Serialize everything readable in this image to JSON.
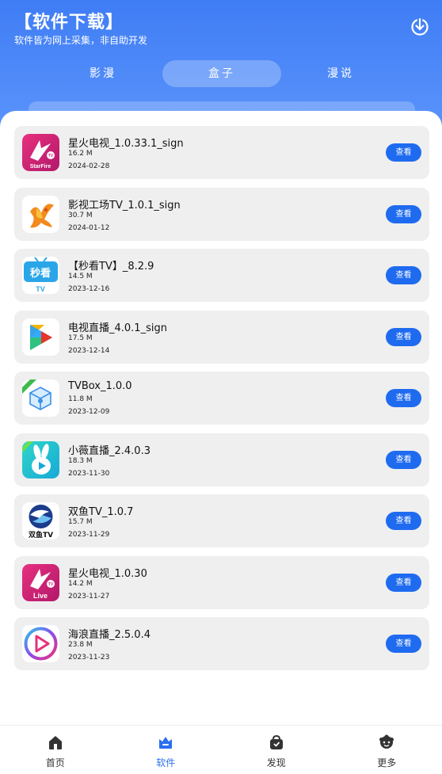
{
  "header": {
    "title": "【软件下载】",
    "subtitle": "软件皆为网上采集，非自助开发",
    "download_icon": "download-icon"
  },
  "tabs": [
    {
      "label": "影漫",
      "active": false
    },
    {
      "label": "盒子",
      "active": true
    },
    {
      "label": "漫说",
      "active": false
    }
  ],
  "apps": [
    {
      "name": "星火电视_1.0.33.1_sign",
      "size": "16.2 M",
      "date": "2024-02-28",
      "button": "查看",
      "icon": "starfire-tv-icon",
      "icon_text": "StarFire"
    },
    {
      "name": "影视工场TV_1.0.1_sign",
      "size": "30.7 M",
      "date": "2024-01-12",
      "button": "查看",
      "icon": "phoenix-icon"
    },
    {
      "name": "【秒看TV】_8.2.9",
      "size": "14.5 M",
      "date": "2023-12-16",
      "button": "查看",
      "icon": "miaokan-tv-icon",
      "icon_text": "秒看",
      "icon_subtext": "TV"
    },
    {
      "name": "电视直播_4.0.1_sign",
      "size": "17.5 M",
      "date": "2023-12-14",
      "button": "查看",
      "icon": "play-logo-icon"
    },
    {
      "name": "TVBox_1.0.0",
      "size": "11.8 M",
      "date": "2023-12-09",
      "button": "查看",
      "icon": "cube-box-icon"
    },
    {
      "name": "小薇直播_2.4.0.3",
      "size": "18.3 M",
      "date": "2023-11-30",
      "button": "查看",
      "icon": "rabbit-icon"
    },
    {
      "name": "双鱼TV_1.0.7",
      "size": "15.7 M",
      "date": "2023-11-29",
      "button": "查看",
      "icon": "fish-tv-icon",
      "icon_text": "双鱼TV"
    },
    {
      "name": "星火电视_1.0.30",
      "size": "14.2 M",
      "date": "2023-11-27",
      "button": "查看",
      "icon": "starfire-live-icon",
      "icon_text": "Live"
    },
    {
      "name": "海浪直播_2.5.0.4",
      "size": "23.8 M",
      "date": "2023-11-23",
      "button": "查看",
      "icon": "play-circle-icon"
    }
  ],
  "nav": [
    {
      "label": "首页",
      "icon": "home-icon",
      "active": false
    },
    {
      "label": "软件",
      "icon": "software-icon",
      "active": true
    },
    {
      "label": "发现",
      "icon": "bag-icon",
      "active": false
    },
    {
      "label": "更多",
      "icon": "more-icon",
      "active": false
    }
  ],
  "colors": {
    "primary": "#3f7df5",
    "button": "#1f6bf0",
    "active_nav": "#2a6ff0"
  }
}
